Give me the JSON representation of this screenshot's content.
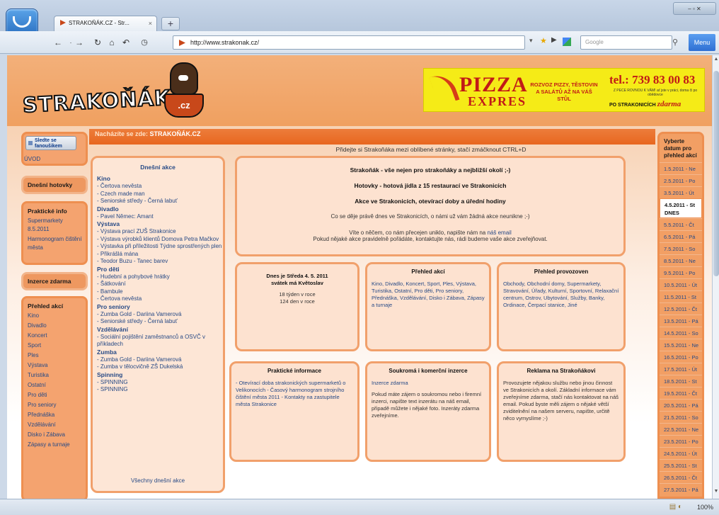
{
  "browser": {
    "tab_title": "STRAKOŇÁK.CZ - Str...",
    "tab_close": "×",
    "new_tab": "+",
    "url": "http://www.strakonak.cz/",
    "search_placeholder": "Google",
    "menu_label": "Menu",
    "zoom": "100%",
    "window_controls": "–  ▫  ✕"
  },
  "site": {
    "logo_text": "STRAKOŇÁK",
    "logo_cz": ".cz",
    "breadcrumb_prefix": "Nacházíte se zde:",
    "breadcrumb_current": "STRAKOŇÁK.CZ",
    "fav_hint": "Přidejte si Strakoňáka mezi oblíbené stránky, stačí zmáčknout CTRL+D"
  },
  "banner": {
    "pizza": "PIZZA",
    "expres": "EXPRES",
    "delivery": "ROZVOZ PIZZY, TĚSTOVIN A SALÁTŮ AŽ NA VÁŠ STŮL",
    "phone": "tel.: 739 83 00 83",
    "small": "Z PECE ROVNOU K VÁM! ať jste v práci, doma či po obědovce",
    "free_prefix": "PO STRAKONICÍCH",
    "free": "zdarma"
  },
  "left": {
    "fav_button": "Sledte se fanoušikem",
    "uvod": "ÚVOD",
    "hotovky": "Dnešní hotovky",
    "prakticke_title": "Praktické info",
    "prakticke_items": [
      "Supermarkety 8.5.2011",
      "Harmonogram čištění města"
    ],
    "inzerce": "Inzerce zdarma",
    "prehled_title": "Přehled akcí",
    "prehled_items": [
      "Kino",
      "Divadlo",
      "Koncert",
      "Sport",
      "Ples",
      "Výstava",
      "Turistika",
      "Ostatní",
      "Pro děti",
      "Pro seniory",
      "Přednáška",
      "Vzdělávání",
      "Disko i Zábava",
      "Zápasy a turnaje"
    ]
  },
  "events": {
    "header": "Dnešní akce",
    "groups": [
      {
        "cat": "Kino",
        "items": [
          "- Čertova nevěsta",
          "- Czech made man",
          "- Seniorské středy - Černá labuť"
        ]
      },
      {
        "cat": "Divadlo",
        "items": [
          "- Pavel Němec: Amant"
        ]
      },
      {
        "cat": "Výstava",
        "items": [
          "- Výstava prací ZUŠ Strakonice",
          "- Výstava výrobků klientů Domova Petra Mačkov",
          "- Výstavka při příležitosti Týdne sprostřených plen",
          "- Přikrášlá mána",
          "- Teodor Buzu - Tanec barev"
        ]
      },
      {
        "cat": "Pro děti",
        "items": [
          "- Hudební a pohybové hrátky",
          "- Šátkování",
          "- Bambule",
          "- Čertova nevěsta"
        ]
      },
      {
        "cat": "Pro seniory",
        "items": [
          "- Zumba Gold - Dariina Vamerová",
          "- Seniorské středy - Černá labuť"
        ]
      },
      {
        "cat": "Vzdělávání",
        "items": [
          "- Sociální pojištění zaměstnanců a OSVČ v příkladech"
        ]
      },
      {
        "cat": "Zumba",
        "items": [
          "- Zumba Gold - Dariina Vamerová",
          "- Zumba v tělocvičně ZŠ Dukelská"
        ]
      },
      {
        "cat": "Spinning",
        "items": [
          "- SPINNING",
          "- SPINNING"
        ]
      }
    ],
    "all_link": "Všechny dnešní akce"
  },
  "intro": {
    "line1": "Strakoňák - vše nejen pro strakoňáky a nejbližší okolí ;-)",
    "line2": "Hotovky - hotová jídla z 15 restaurací ve Strakonicích",
    "line3": "Akce ve Strakonicích, otevírací doby a úřední hodiny",
    "line4": "Co se děje právě dnes ve Strakonicích, o námi už vám žádná akce neunikne ;-)",
    "line5a": "Víte o něčem, co nám přecejen uniklo, napište nám na",
    "line5_link": "náš email",
    "line6": "Pokud nějaké akce pravidelně pořádáte, kontaktujte nás, rádi budeme vaše akce zveřejňovat."
  },
  "cards": {
    "today_title": "Dnes je Středa 4. 5. 2011",
    "today_sub": "svátek má Květoslav",
    "today_week": "18 týden v roce",
    "today_day": "124 den v roce",
    "akce_title": "Přehled akcí",
    "akce_links": "Kino, Divadlo, Koncert, Sport, Ples, Výstava, Turistika, Ostatní, Pro děti, Pro seniory, Přednáška, Vzdělávání, Disko i Zábava, Zápasy a turnaje",
    "provozovny_title": "Přehled provozoven",
    "provozovny_links": "Obchody, Obchodní domy, Supermarkety, Stravování, Úřady, Kulturní, Sportovní, Relaxační centrum, Ostrov, Ubytování, Služby, Banky, Ordinace, Čerpací stanice, Jiné",
    "prakticke_title": "Praktické informace",
    "prakticke_links": "- Otevírací doba strakonických supermarketů o Velikonocích - Časový harmonogram strojního čištění města 2011 - Kontakty na zastupitele města Strakonice",
    "inzerce_title": "Soukromá i komerční inzerce",
    "inzerce_link": "Inzerce zdarma",
    "inzerce_text": "Pokud máte zájem o soukromou nebo i firemní inzerci, napište text inzerátu na náš email, připadě můžete i nějaké foto. Inzeráty zdarma zveřejníme.",
    "reklama_title": "Reklama na Strakoňákovi",
    "reklama_text": "Provozujete nějakou službu nebo jinou činnost ve Strakonicích a okolí. Základní informace vám zveřejníme zdarma, stačí nás kontaktovat na náš email. Pokud byste měli zájem o nějaké větší zviditelnění na našem serveru, napište, určitě něco vymyslíme ;-)"
  },
  "calendar": {
    "title": "Vyberte datum pro přehled akcí",
    "dates": [
      "1.5.2011 - Ne",
      "2.5.2011 - Po",
      "3.5.2011 - Út",
      "4.5.2011 - St DNES",
      "5.5.2011 - Čt",
      "6.5.2011 - Pá",
      "7.5.2011 - So",
      "8.5.2011 - Ne",
      "9.5.2011 - Po",
      "10.5.2011 - Út",
      "11.5.2011 - St",
      "12.5.2011 - Čt",
      "13.5.2011 - Pá",
      "14.5.2011 - So",
      "15.5.2011 - Ne",
      "16.5.2011 - Po",
      "17.5.2011 - Út",
      "18.5.2011 - St",
      "19.5.2011 - Čt",
      "20.5.2011 - Pá",
      "21.5.2011 - So",
      "22.5.2011 - Ne",
      "23.5.2011 - Po",
      "24.5.2011 - Út",
      "25.5.2011 - St",
      "26.5.2011 - Čt",
      "27.5.2011 - Pá"
    ],
    "today_index": 3
  }
}
